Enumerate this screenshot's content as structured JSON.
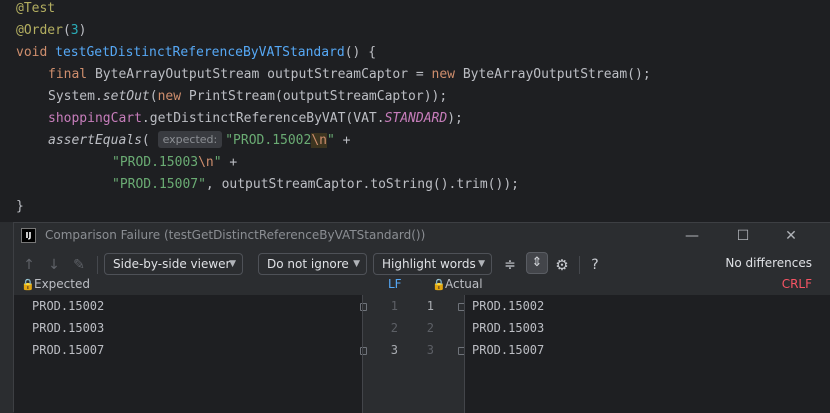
{
  "code": {
    "annotation_test": "@Test",
    "annotation_order": "@Order",
    "order_num": "3",
    "order_open": "(",
    "order_close": ")",
    "void_kw": "void",
    "method_name": "testGetDistinctReferenceByVATStandard",
    "method_tail": "() {",
    "line4_final": "final",
    "line4_type": " ByteArrayOutputStream outputStreamCaptor = ",
    "line4_new": "new",
    "line4_rest": " ByteArrayOutputStream();",
    "line5_a": "System.",
    "line5_setout": "setOut",
    "line5_b": "(",
    "line5_new": "new",
    "line5_c": " PrintStream(outputStreamCaptor));",
    "line6_field": "shoppingCart",
    "line6_a": ".getDistinctReferenceByVAT(VAT.",
    "line6_const": "STANDARD",
    "line6_b": ");",
    "line7_assert": "assertEquals",
    "line7_paren": "(",
    "line7_hint": "expected:",
    "line7_str1": "\"PROD.15002",
    "line7_esc": "\\n",
    "line7_str1_end": "\"",
    "line7_plus": " +",
    "line8_str": "\"PROD.15003",
    "line8_esc": "\\n",
    "line8_str_end": "\"",
    "line8_plus": " +",
    "line9_str": "\"PROD.15007\"",
    "line9_rest": ", outputStreamCaptor.toString().trim());",
    "closing_brace": "}"
  },
  "dialog": {
    "logo": "IJ",
    "title": "Comparison Failure (testGetDistinctReferenceByVATStandard())",
    "minimize": "—",
    "maximize": "☐",
    "close": "✕",
    "toolbar": {
      "viewer": "Side-by-side viewer",
      "whitespace": "Do not ignore",
      "highlight": "Highlight words",
      "help": "?",
      "status": "No differences"
    },
    "expected_label": "Expected",
    "actual_label": "Actual",
    "lf_label": "LF",
    "crlf_label": "CRLF",
    "expected_lines": [
      "PROD.15002",
      "PROD.15003",
      "PROD.15007"
    ],
    "actual_lines": [
      "PROD.15002",
      "PROD.15003",
      "PROD.15007"
    ],
    "left_line_numbers": [
      "1",
      "2",
      "3"
    ],
    "right_line_numbers": [
      "1",
      "2",
      "3"
    ]
  },
  "colors": {
    "editor_bg": "#1e1f22",
    "dialog_bg": "#2b2d30",
    "keyword": "#cf8e6d",
    "function": "#56a8f5",
    "string": "#6aab73",
    "annotation": "#b3ae60",
    "field": "#c77dbb",
    "crlf": "#f75464"
  },
  "icons": [
    "arrow-up-icon",
    "arrow-down-icon",
    "edit-icon",
    "collapse-unchanged-icon",
    "sync-scroll-icon",
    "settings-icon",
    "help-icon",
    "lock-icon",
    "fold-marker-icon"
  ]
}
